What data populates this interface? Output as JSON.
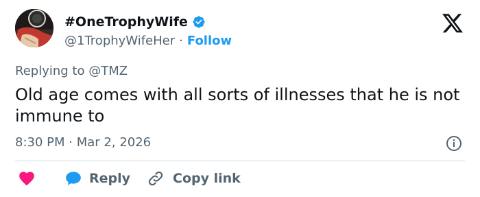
{
  "author": {
    "display_name": "#OneTrophyWife",
    "handle": "@1TrophyWifeHer",
    "separator": "·",
    "follow_label": "Follow",
    "verified": true
  },
  "reply_context": {
    "prefix": "Replying to ",
    "target": "@TMZ"
  },
  "tweet": {
    "text": "Old age comes with all sorts of illnesses that he is not immune to",
    "time": "8:30 PM",
    "separator": "·",
    "date": "Mar 2, 2026"
  },
  "actions": {
    "like_icon": "heart-icon",
    "reply_label": "Reply",
    "copy_link_label": "Copy link"
  },
  "icons": {
    "brand": "x-logo",
    "info": "info-icon",
    "verified": "verified-badge-icon",
    "reply": "speech-bubble-icon",
    "copy": "link-icon"
  },
  "colors": {
    "accent": "#1d9bf0",
    "like": "#f91880",
    "text": "#0f1419",
    "muted": "#536471",
    "divider": "#cfd9de"
  }
}
